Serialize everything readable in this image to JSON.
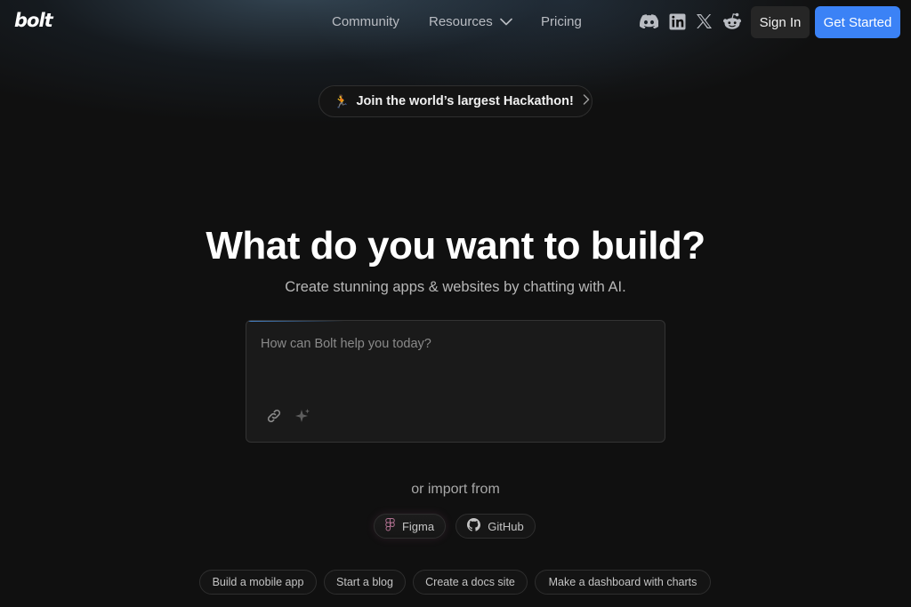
{
  "header": {
    "logo": "bolt",
    "nav": [
      {
        "label": "Community"
      },
      {
        "label": "Resources"
      },
      {
        "label": "Pricing"
      }
    ],
    "socials": [
      "discord-icon",
      "linkedin-icon",
      "x-icon",
      "reddit-icon"
    ],
    "sign_in": "Sign In",
    "get_started": "Get Started"
  },
  "announcement": {
    "emoji": "🏃",
    "text": "Join the world’s largest Hackathon!"
  },
  "hero": {
    "title": "What do you want to build?",
    "subtitle": "Create stunning apps & websites by chatting with AI."
  },
  "prompt": {
    "placeholder": "How can Bolt help you today?",
    "value": ""
  },
  "import": {
    "label": "or import from",
    "options": [
      {
        "label": "Figma",
        "icon": "figma-icon"
      },
      {
        "label": "GitHub",
        "icon": "github-icon"
      }
    ]
  },
  "suggestions": [
    "Build a mobile app",
    "Start a blog",
    "Create a docs site",
    "Make a dashboard with charts"
  ],
  "colors": {
    "background": "#101010",
    "accent": "#3b82f6",
    "sign_in_bg": "#262626"
  }
}
